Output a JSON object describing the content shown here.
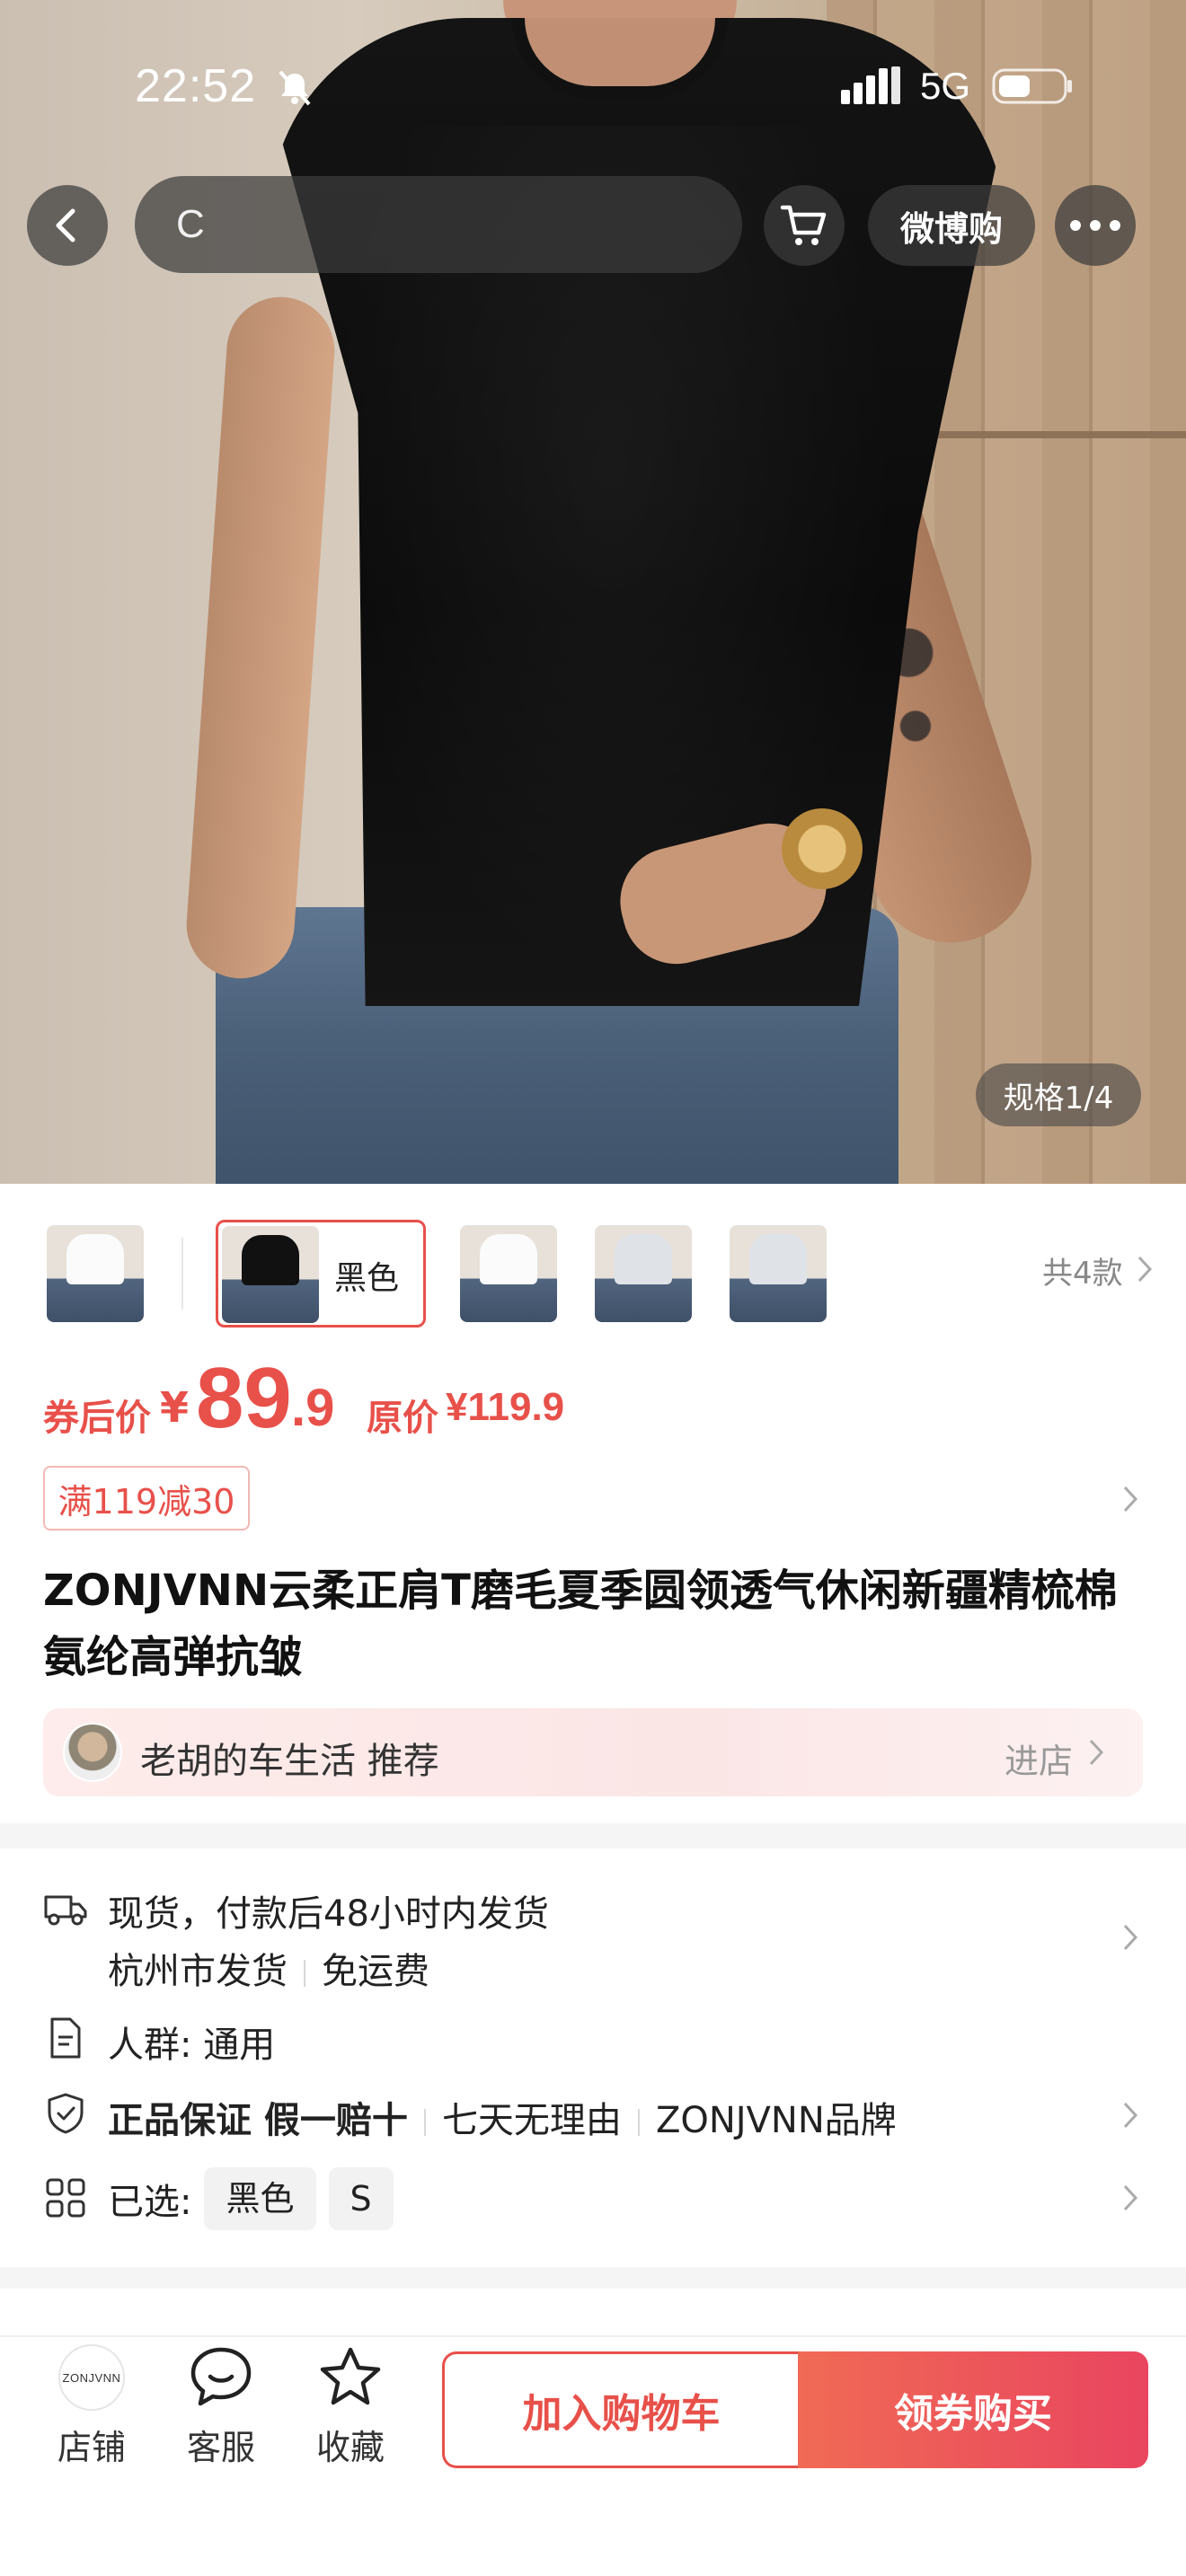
{
  "status_bar": {
    "time": "22:52",
    "network": "5G"
  },
  "nav": {
    "search_text": "C",
    "weibo_label": "微博购"
  },
  "hero": {
    "spec_badge": "规格1/4"
  },
  "variants": {
    "selected_label": "黑色",
    "count_label": "共4款"
  },
  "price": {
    "coupon_label": "券后价",
    "currency": "¥",
    "integer": "89",
    "decimal": ".9",
    "original_label": "原价",
    "original_price": "¥119.9"
  },
  "promo": {
    "tag": "满119减30"
  },
  "product": {
    "title": "ZONJVNN云柔正肩T磨毛夏季圆领透气休闲新疆精梳棉氨纶高弹抗皱"
  },
  "recommend": {
    "text": "老胡的车生活 推荐",
    "enter_label": "进店"
  },
  "service": {
    "shipping_line1": "现货，付款后48小时内发货",
    "shipping_city": "杭州市发货",
    "shipping_fee": "免运费",
    "audience": "人群: 通用",
    "guarantee_strong": "正品保证 假一赔十",
    "guarantee_return": "七天无理由",
    "guarantee_brand": "ZONJVNN品牌",
    "selected_label": "已选:",
    "selected_color": "黑色",
    "selected_size": "S"
  },
  "bottom_bar": {
    "shop_logo_text": "ZONJVNN",
    "shop_label": "店铺",
    "service_label": "客服",
    "favorite_label": "收藏",
    "add_cart_label": "加入购物车",
    "buy_label": "领券购买"
  },
  "colors": {
    "accent": "#e8504a",
    "buy_gradient_start": "#f06a55",
    "buy_gradient_end": "#e9455f"
  }
}
